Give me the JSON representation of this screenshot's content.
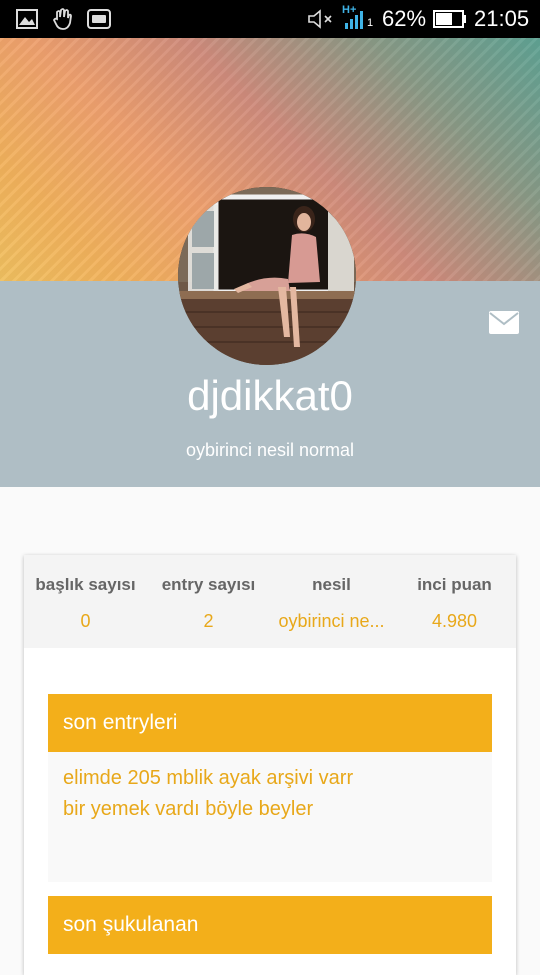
{
  "status_bar": {
    "battery_percent": "62%",
    "time": "21:05",
    "network_label": "H+",
    "signal_sub": "1"
  },
  "profile": {
    "username": "djdikkat0",
    "subtitle": "oybirinci nesil normal"
  },
  "stats": [
    {
      "label": "başlık sayısı",
      "value": "0"
    },
    {
      "label": "entry sayısı",
      "value": "2"
    },
    {
      "label": "nesil",
      "value": "oybirinci ne..."
    },
    {
      "label": "inci puan",
      "value": "4.980"
    }
  ],
  "sections": {
    "recent_entries_title": "son entryleri",
    "recent_entries": [
      "elimde 205 mblik ayak arşivi varr",
      "bir yemek vardı böyle beyler"
    ],
    "upvoted_title": "son şukulanan"
  },
  "colors": {
    "accent": "#f3af1a",
    "accent_text": "#e8a81a",
    "header_bg": "#afbec5"
  }
}
